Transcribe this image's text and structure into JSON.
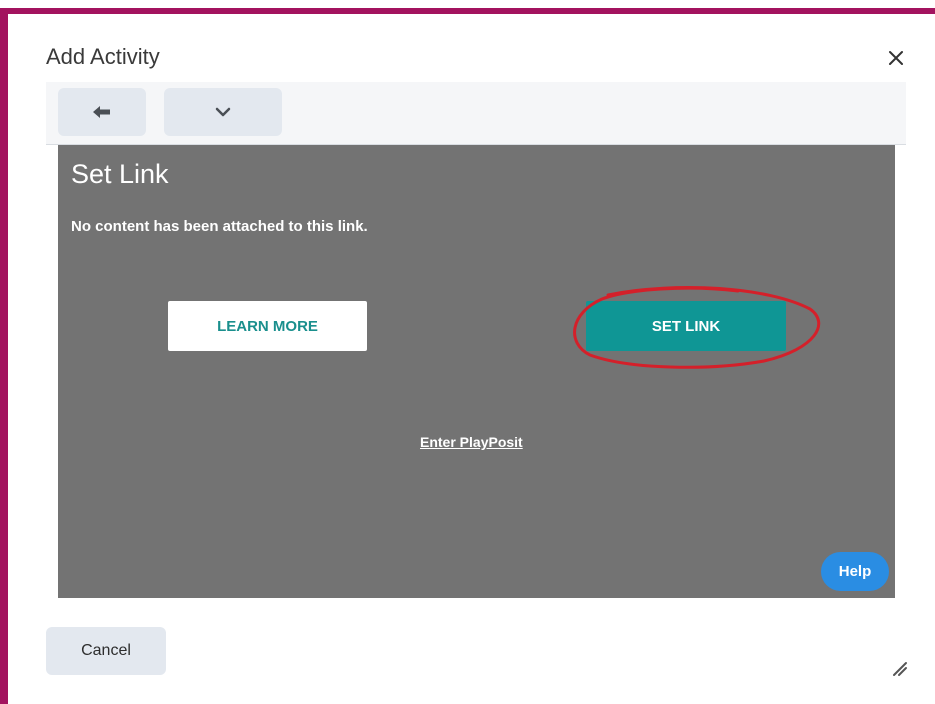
{
  "dialog": {
    "title": "Add Activity",
    "close_icon": "close-icon"
  },
  "toolbar": {
    "back_icon": "arrow-left-icon",
    "more_icon": "chevron-down-icon"
  },
  "panel": {
    "title": "Set Link",
    "message": "No content has been attached to this link.",
    "learn_more_label": "LEARN MORE",
    "set_link_label": "SET LINK",
    "enter_link_label": "Enter PlayPosit",
    "help_label": "Help"
  },
  "footer": {
    "cancel_label": "Cancel",
    "resize_icon": "resize-handle-icon"
  },
  "colors": {
    "frame_border": "#a3135f",
    "panel_bg": "#737373",
    "accent_teal": "#0f9695",
    "help_blue": "#2a8de3",
    "annotation_red": "#d4202a"
  }
}
